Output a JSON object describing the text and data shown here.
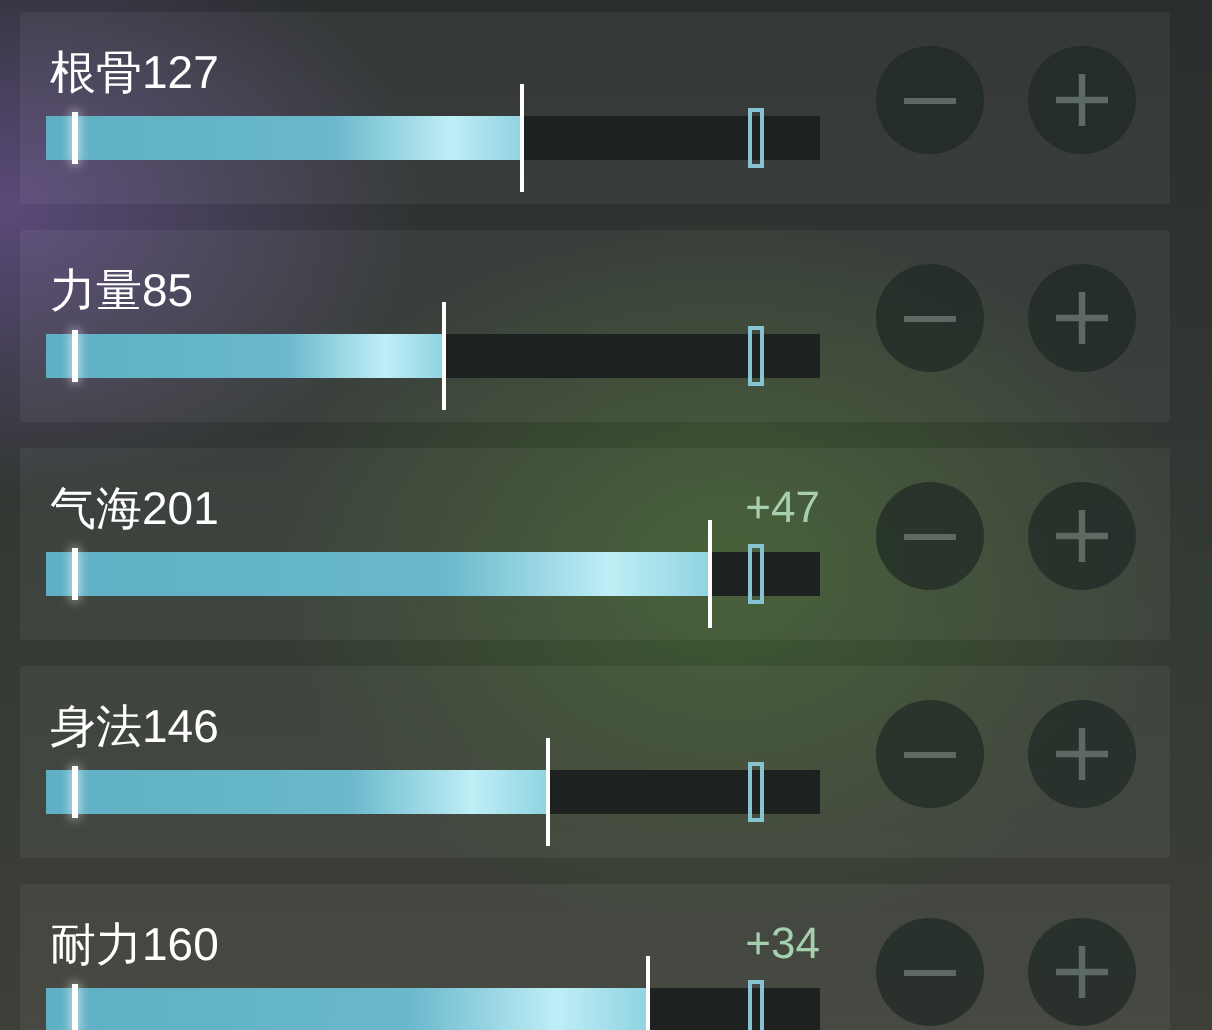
{
  "attributes": [
    {
      "label": "根骨127",
      "level": 0.615
    },
    {
      "label": "力量85",
      "level": 0.514
    },
    {
      "label": "气海201",
      "level": 0.858,
      "bonus": "+47"
    },
    {
      "label": "身法146",
      "level": 0.649
    },
    {
      "label": "耐力160",
      "level": 0.778,
      "bonus": "+34"
    }
  ]
}
